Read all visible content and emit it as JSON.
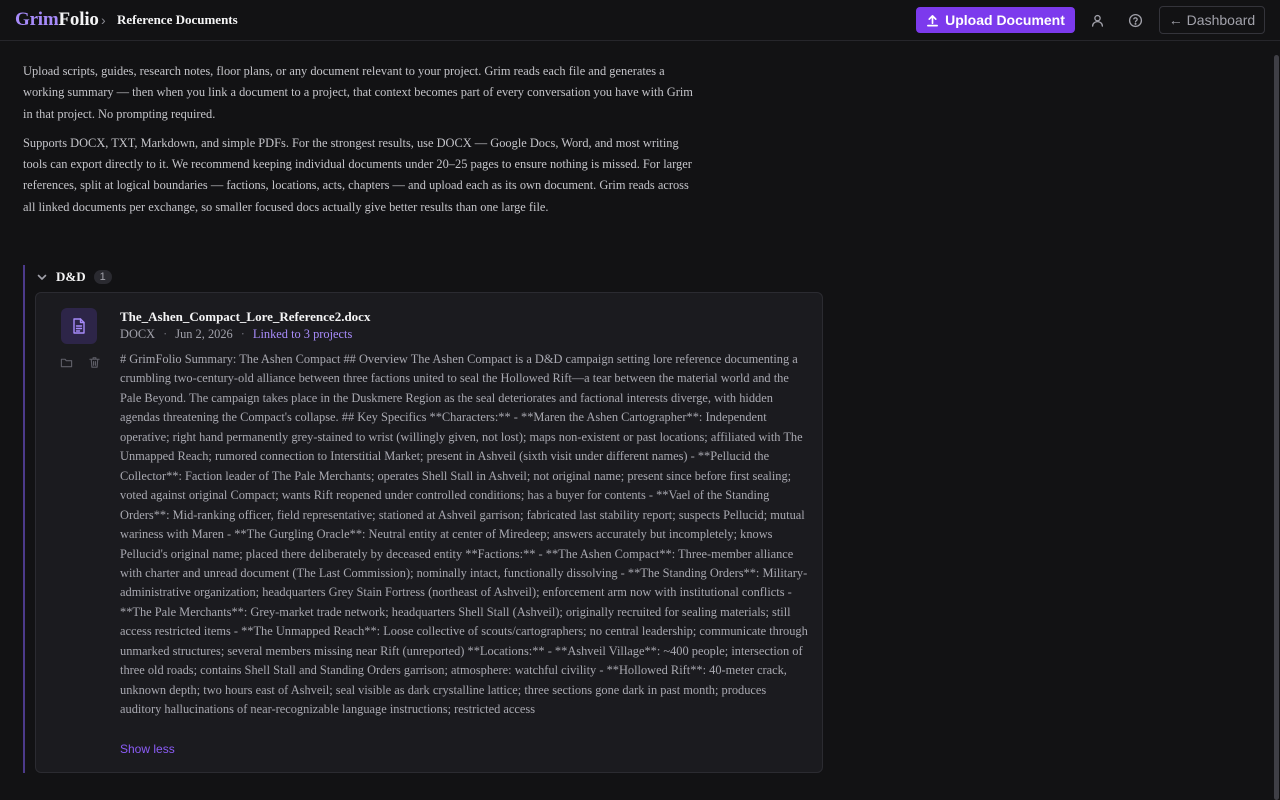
{
  "header": {
    "brand_part1": "Grim",
    "brand_part2": "Folio",
    "breadcrumb_sep": "›",
    "breadcrumb_current": "Reference Documents",
    "upload_label": "Upload Document",
    "dashboard_label": "← Dashboard"
  },
  "intro": {
    "p1": "Upload scripts, guides, research notes, floor plans, or any document relevant to your project. Grim reads each file and generates a working summary — then when you link a document to a project, that context becomes part of every conversation you have with Grim in that project. No prompting required.",
    "p2": "Supports DOCX, TXT, Markdown, and simple PDFs. For the strongest results, use DOCX — Google Docs, Word, and most writing tools can export directly to it. We recommend keeping individual documents under 20–25 pages to ensure nothing is missed. For larger references, split at logical boundaries — factions, locations, acts, chapters — and upload each as its own document. Grim reads across all linked documents per exchange, so smaller focused docs actually give better results than one large file."
  },
  "group": {
    "title": "D&D",
    "count": "1"
  },
  "document": {
    "filename": "The_Ashen_Compact_Lore_Reference2.docx",
    "type": "DOCX",
    "date": "Jun 2, 2026",
    "dot": "·",
    "linked": "Linked to 3 projects",
    "summary": "# GrimFolio Summary: The Ashen Compact ## Overview The Ashen Compact is a D&D campaign setting lore reference documenting a crumbling two-century-old alliance between three factions united to seal the Hollowed Rift—a tear between the material world and the Pale Beyond. The campaign takes place in the Duskmere Region as the seal deteriorates and factional interests diverge, with hidden agendas threatening the Compact's collapse. ## Key Specifics **Characters:** - **Maren the Ashen Cartographer**: Independent operative; right hand permanently grey-stained to wrist (willingly given, not lost); maps non-existent or past locations; affiliated with The Unmapped Reach; rumored connection to Interstitial Market; present in Ashveil (sixth visit under different names) - **Pellucid the Collector**: Faction leader of The Pale Merchants; operates Shell Stall in Ashveil; not original name; present since before first sealing; voted against original Compact; wants Rift reopened under controlled conditions; has a buyer for contents - **Vael of the Standing Orders**: Mid-ranking officer, field representative; stationed at Ashveil garrison; fabricated last stability report; suspects Pellucid; mutual wariness with Maren - **The Gurgling Oracle**: Neutral entity at center of Miredeep; answers accurately but incompletely; knows Pellucid's original name; placed there deliberately by deceased entity **Factions:** - **The Ashen Compact**: Three-member alliance with charter and unread document (The Last Commission); nominally intact, functionally dissolving - **The Standing Orders**: Military-administrative organization; headquarters Grey Stain Fortress (northeast of Ashveil); enforcement arm now with institutional conflicts - **The Pale Merchants**: Grey-market trade network; headquarters Shell Stall (Ashveil); originally recruited for sealing materials; still access restricted items - **The Unmapped Reach**: Loose collective of scouts/cartographers; no central leadership; communicate through unmarked structures; several members missing near Rift (unreported) **Locations:** - **Ashveil Village**: ~400 people; intersection of three old roads; contains Shell Stall and Standing Orders garrison; atmosphere: watchful civility - **Hollowed Rift**: 40-meter crack, unknown depth; two hours east of Ashveil; seal visible as dark crystalline lattice; three sections gone dark in past month; produces auditory hallucinations of near-recognizable language instructions; restricted access",
    "show_less": "Show less"
  },
  "colors": {
    "accent": "#7c3aed",
    "accent_text": "#a78bfa",
    "background": "#121214",
    "card": "#1b1b1f"
  },
  "icons": {
    "upload": "upload-icon",
    "user": "user-icon",
    "help": "help-circle-icon",
    "chevron": "chevron-down-icon",
    "file": "file-text-icon",
    "folder": "folder-icon",
    "trash": "trash-icon"
  }
}
